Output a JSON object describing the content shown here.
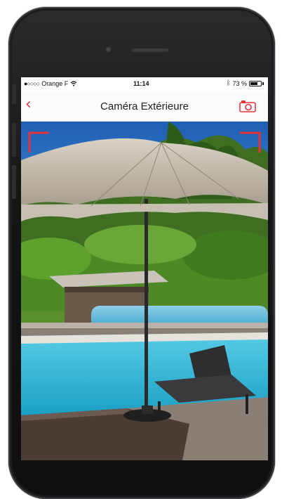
{
  "status_bar": {
    "carrier": "Orange F",
    "time": "11:14",
    "battery": "73 %",
    "battery_level": 0.73
  },
  "nav": {
    "back_icon": "chevron-left-icon",
    "title": "Caméra Extérieure",
    "snapshot_icon": "camera-icon"
  },
  "colors": {
    "accent": "#e2343a",
    "sky": "#1e63b8",
    "pool": "#2fb9d8"
  },
  "feed": {
    "scene": "outdoor-camera-live-view"
  }
}
